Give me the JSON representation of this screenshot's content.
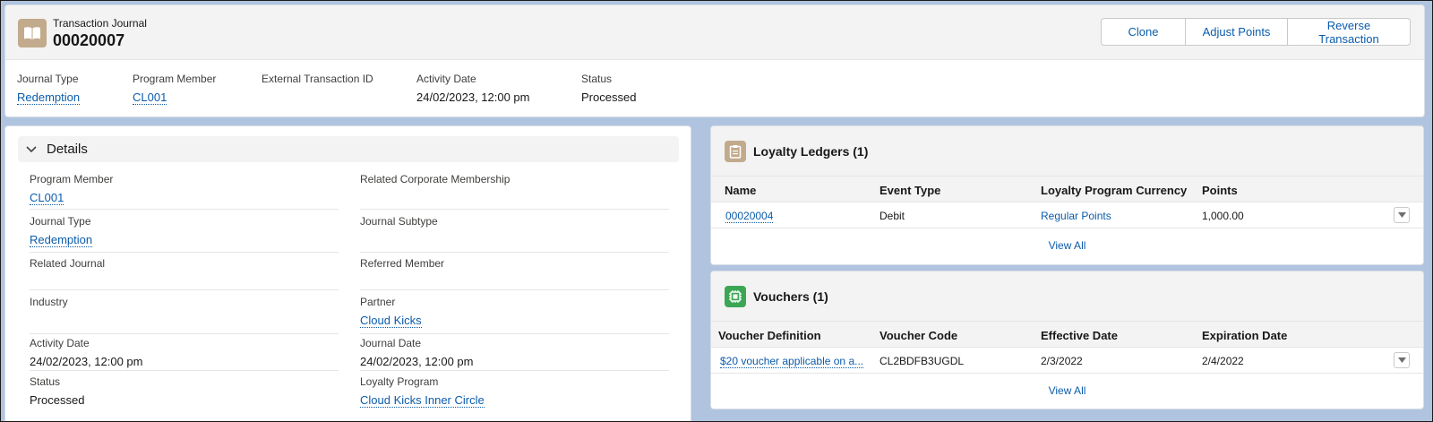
{
  "header": {
    "object_label": "Transaction Journal",
    "record_name": "00020007",
    "buttons": {
      "clone": "Clone",
      "adjust_points": "Adjust Points",
      "reverse_transaction": "Reverse Transaction"
    },
    "icon": "journal-book-icon",
    "icon_color": "#c2aa8c"
  },
  "highlights": [
    {
      "label": "Journal Type",
      "value": "Redemption",
      "link": true
    },
    {
      "label": "Program Member",
      "value": "CL001",
      "link": true
    },
    {
      "label": "External Transaction ID",
      "value": "",
      "link": false
    },
    {
      "label": "Activity Date",
      "value": "24/02/2023, 12:00 pm",
      "link": false
    },
    {
      "label": "Status",
      "value": "Processed",
      "link": false
    }
  ],
  "details": {
    "section_title": "Details",
    "fields": [
      {
        "label": "Program Member",
        "value": "CL001",
        "link": true
      },
      {
        "label": "Related Corporate Membership",
        "value": "",
        "link": false
      },
      {
        "label": "Journal Type",
        "value": "Redemption",
        "link": true
      },
      {
        "label": "Journal Subtype",
        "value": "",
        "link": false
      },
      {
        "label": "Related Journal",
        "value": "",
        "link": false
      },
      {
        "label": "Referred Member",
        "value": "",
        "link": false
      },
      {
        "label": "Industry",
        "value": "",
        "link": false
      },
      {
        "label": "Partner",
        "value": "Cloud Kicks",
        "link": true
      },
      {
        "label": "Activity Date",
        "value": "24/02/2023, 12:00 pm",
        "link": false
      },
      {
        "label": "Journal Date",
        "value": "24/02/2023, 12:00 pm",
        "link": false
      },
      {
        "label": "Status",
        "value": "Processed",
        "link": false
      },
      {
        "label": "Loyalty Program",
        "value": "Cloud Kicks Inner Circle",
        "link": true
      }
    ]
  },
  "ledgers": {
    "title": "Loyalty Ledgers (1)",
    "icon": "clipboard-icon",
    "icon_color": "#c2aa8c",
    "columns": [
      "Name",
      "Event Type",
      "Loyalty Program Currency",
      "Points"
    ],
    "rows": [
      {
        "name": "00020004",
        "event_type": "Debit",
        "currency": "Regular Points",
        "points": "1,000.00"
      }
    ],
    "view_all": "View All"
  },
  "vouchers": {
    "title": "Vouchers (1)",
    "icon": "voucher-chip-icon",
    "icon_color": "#3ba755",
    "columns": [
      "Voucher Definition",
      "Voucher Code",
      "Effective Date",
      "Expiration Date"
    ],
    "rows": [
      {
        "definition": "$20 voucher applicable on a...",
        "code": "CL2BDFB3UGDL",
        "effective": "2/3/2022",
        "expiration": "2/4/2022"
      }
    ],
    "view_all": "View All"
  }
}
